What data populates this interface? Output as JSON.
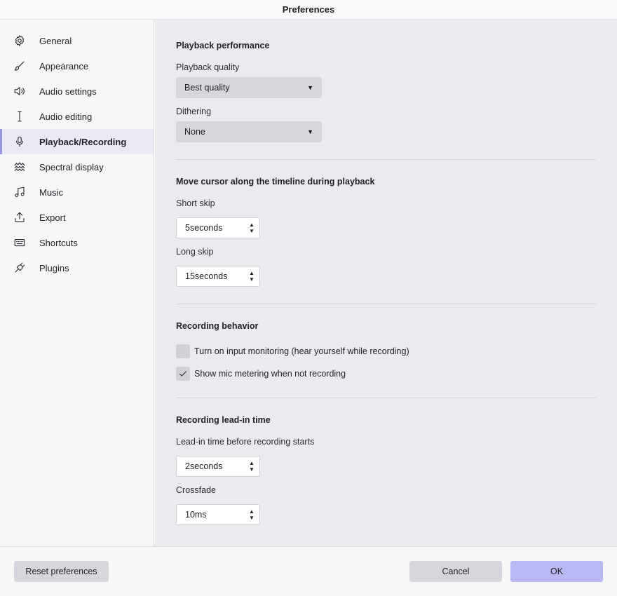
{
  "window": {
    "title": "Preferences"
  },
  "sidebar": {
    "items": [
      {
        "label": "General",
        "icon": "gear-icon"
      },
      {
        "label": "Appearance",
        "icon": "brush-icon"
      },
      {
        "label": "Audio settings",
        "icon": "speaker-icon"
      },
      {
        "label": "Audio editing",
        "icon": "text-cursor-icon"
      },
      {
        "label": "Playback/Recording",
        "icon": "microphone-icon",
        "active": true
      },
      {
        "label": "Spectral display",
        "icon": "waves-icon"
      },
      {
        "label": "Music",
        "icon": "music-note-icon"
      },
      {
        "label": "Export",
        "icon": "upload-icon"
      },
      {
        "label": "Shortcuts",
        "icon": "keyboard-icon"
      },
      {
        "label": "Plugins",
        "icon": "plug-icon"
      }
    ]
  },
  "playback": {
    "title": "Playback performance",
    "quality_label": "Playback quality",
    "quality_value": "Best quality",
    "dithering_label": "Dithering",
    "dithering_value": "None"
  },
  "cursor": {
    "title": "Move cursor along the timeline during playback",
    "short_label": "Short skip",
    "short_value": "5seconds",
    "long_label": "Long skip",
    "long_value": "15seconds"
  },
  "recording": {
    "title": "Recording behavior",
    "monitoring_label": "Turn on input monitoring (hear yourself while recording)",
    "monitoring_checked": false,
    "metering_label": "Show mic metering when not recording",
    "metering_checked": true
  },
  "leadin": {
    "title": "Recording lead-in time",
    "time_label": "Lead-in time before recording starts",
    "time_value": "2seconds",
    "crossfade_label": "Crossfade",
    "crossfade_value": "10ms"
  },
  "footer": {
    "reset_label": "Reset preferences",
    "cancel_label": "Cancel",
    "ok_label": "OK"
  },
  "colors": {
    "accent": "#bab8f2",
    "active_bg": "#eaeaf6",
    "active_bar": "#9a98e6",
    "content_bg": "#ebebef"
  }
}
